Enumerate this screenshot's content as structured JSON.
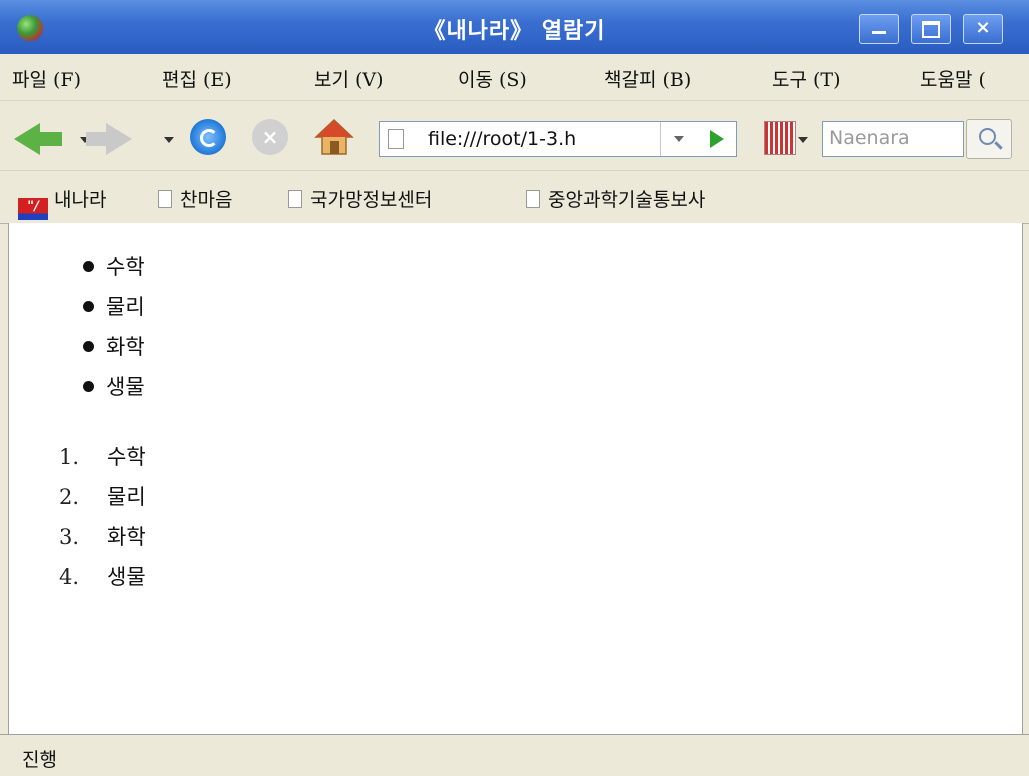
{
  "window": {
    "title": "《내나라》 열람기"
  },
  "menu": {
    "items": [
      "파일 (F)",
      "편집 (E)",
      "보기 (V)",
      "이동 (S)",
      "책갈피 (B)",
      "도구 (T)",
      "도움말 ("
    ]
  },
  "toolbar": {
    "url": "file:///root/1-3.h",
    "search_placeholder": "Naenara"
  },
  "bookmarks": {
    "items": [
      "내나라",
      "찬마음",
      "국가망정보센터",
      "중앙과학기술통보사"
    ]
  },
  "content": {
    "unordered_list": [
      "수학",
      "물리",
      "화학",
      "생물"
    ],
    "ordered_list": {
      "numbers": [
        "1.",
        "2.",
        "3.",
        "4."
      ],
      "items": [
        "수학",
        "물리",
        "화학",
        "생물"
      ]
    }
  },
  "status": {
    "text": "진행"
  },
  "colors": {
    "titlebar": "#3a6fd1",
    "chrome": "#ece9d8",
    "go_arrow": "#2ea02e",
    "back_arrow": "#5cb245"
  }
}
